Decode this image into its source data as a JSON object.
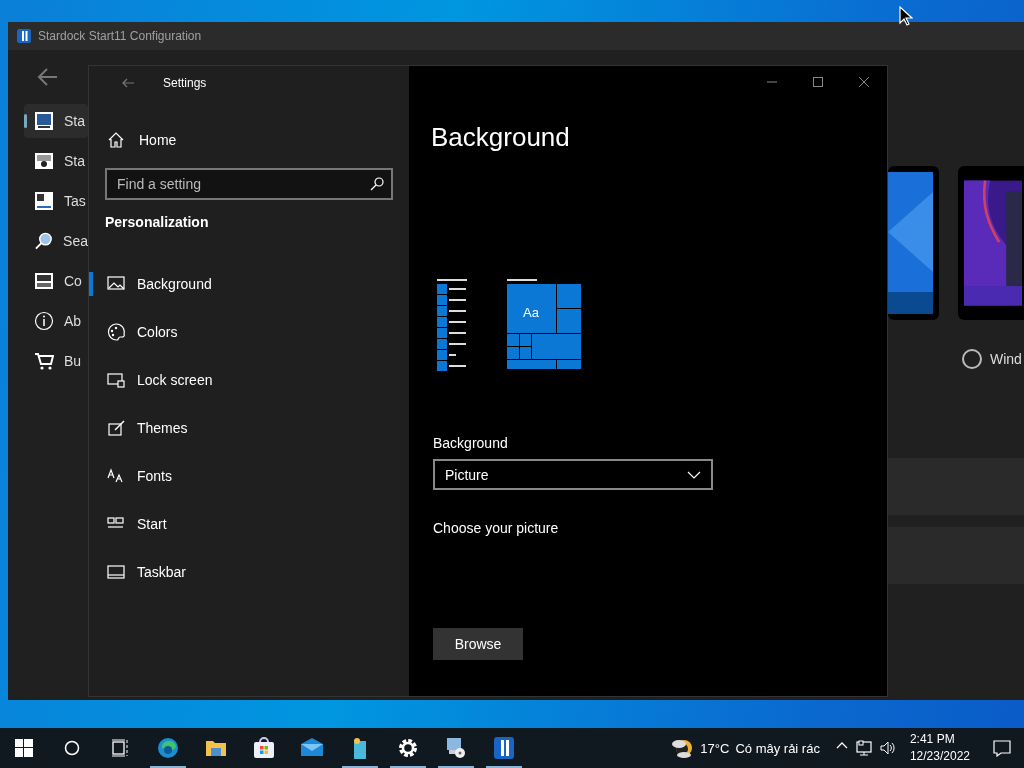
{
  "stardock": {
    "title": "Stardock Start11 Configuration",
    "nav": [
      {
        "label": "Sta",
        "kind": "start",
        "selected": true
      },
      {
        "label": "Sta",
        "kind": "camera",
        "selected": false
      },
      {
        "label": "Tas",
        "kind": "taskbar",
        "selected": false
      },
      {
        "label": "Sea",
        "kind": "search",
        "selected": false
      },
      {
        "label": "Co",
        "kind": "keyboard",
        "selected": false
      },
      {
        "label": "Ab",
        "kind": "info",
        "selected": false
      },
      {
        "label": "Bu",
        "kind": "cart",
        "selected": false
      }
    ],
    "radio": {
      "label": "Wind",
      "checked": false
    }
  },
  "settings": {
    "title": "Settings",
    "home": "Home",
    "search": {
      "placeholder": "Find a setting"
    },
    "section": "Personalization",
    "nav": [
      {
        "label": "Background",
        "kind": "picture",
        "selected": true
      },
      {
        "label": "Colors",
        "kind": "palette",
        "selected": false
      },
      {
        "label": "Lock screen",
        "kind": "lock",
        "selected": false
      },
      {
        "label": "Themes",
        "kind": "brush",
        "selected": false
      },
      {
        "label": "Fonts",
        "kind": "fonts",
        "selected": false
      },
      {
        "label": "Start",
        "kind": "start",
        "selected": false
      },
      {
        "label": "Taskbar",
        "kind": "taskbar",
        "selected": false
      }
    ],
    "page_title": "Background",
    "tile_label": "Aa",
    "background_field": {
      "label": "Background",
      "value": "Picture"
    },
    "choose_label": "Choose your picture",
    "browse": "Browse"
  },
  "taskbar": {
    "apps": [
      {
        "kind": "edge",
        "running": true
      },
      {
        "kind": "folder",
        "running": false
      },
      {
        "kind": "store",
        "running": false
      },
      {
        "kind": "mail",
        "running": false
      },
      {
        "kind": "tool",
        "running": true
      },
      {
        "kind": "gear",
        "running": true
      },
      {
        "kind": "remote",
        "running": true
      },
      {
        "kind": "stardock",
        "running": true
      }
    ],
    "temperature": "17°C",
    "weather": "Có mây rải rác",
    "time": "2:41 PM",
    "date": "12/23/2022"
  }
}
